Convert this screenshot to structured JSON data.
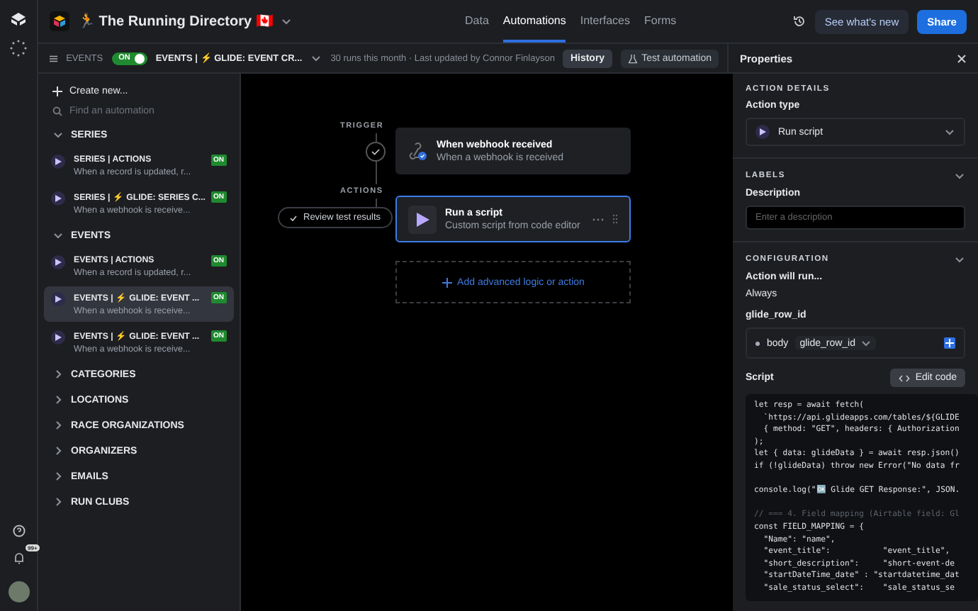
{
  "topbar": {
    "base_emoji": "🏃",
    "base_name": "The Running Directory",
    "flag": "🇨🇦",
    "nav": [
      {
        "label": "Data",
        "selected": false
      },
      {
        "label": "Automations",
        "selected": true
      },
      {
        "label": "Interfaces",
        "selected": false
      },
      {
        "label": "Forms",
        "selected": false
      }
    ],
    "whats_new": "See what's new",
    "share": "Share"
  },
  "subbar": {
    "section": "EVENTS",
    "toggle": {
      "label": "ON",
      "on": true
    },
    "automation_name": "EVENTS | ⚡ GLIDE: EVENT CR...",
    "runs_info": "30 runs this month · Last updated by Connor Finlayson",
    "history": "History",
    "test": "Test automation"
  },
  "sidebar": {
    "create": "Create new...",
    "search_placeholder": "Find an automation",
    "groups": [
      {
        "label": "SERIES",
        "expanded": true,
        "items": [
          {
            "title": "SERIES | ACTIONS",
            "subtitle": "When a record is updated, r...",
            "on_label": "ON",
            "selected": false
          },
          {
            "title": "SERIES | ⚡ GLIDE: SERIES C...",
            "subtitle": "When a webhook is receive...",
            "on_label": "ON",
            "selected": false
          }
        ]
      },
      {
        "label": "EVENTS",
        "expanded": true,
        "items": [
          {
            "title": "EVENTS | ACTIONS",
            "subtitle": "When a record is updated, r...",
            "on_label": "ON",
            "selected": false
          },
          {
            "title": "EVENTS | ⚡ GLIDE: EVENT ...",
            "subtitle": "When a webhook is receive...",
            "on_label": "ON",
            "selected": true
          },
          {
            "title": "EVENTS | ⚡ GLIDE: EVENT ...",
            "subtitle": "When a webhook is receive...",
            "on_label": "ON",
            "selected": false
          }
        ]
      },
      {
        "label": "CATEGORIES",
        "expanded": false
      },
      {
        "label": "LOCATIONS",
        "expanded": false
      },
      {
        "label": "RACE ORGANIZATIONS",
        "expanded": false
      },
      {
        "label": "ORGANIZERS",
        "expanded": false
      },
      {
        "label": "EMAILS",
        "expanded": false
      },
      {
        "label": "RUN CLUBS",
        "expanded": false
      }
    ]
  },
  "rail": {
    "notification_badge": "99+"
  },
  "canvas": {
    "trigger_label": "TRIGGER",
    "actions_label": "ACTIONS",
    "review": "Review test results",
    "trigger": {
      "title": "When webhook received",
      "subtitle": "When a webhook is received"
    },
    "action": {
      "title": "Run a script",
      "subtitle": "Custom script from code editor",
      "selected": true
    },
    "add": "Add advanced logic or action"
  },
  "properties": {
    "title": "Properties",
    "action_details": "ACTION DETAILS",
    "action_type_label": "Action type",
    "action_type": "Run script",
    "labels": "LABELS",
    "description_label": "Description",
    "description_placeholder": "Enter a description",
    "configuration": "CONFIGURATION",
    "will_run_label": "Action will run...",
    "will_run": "Always",
    "param_name": "glide_row_id",
    "param_source": "body",
    "param_value": "glide_row_id",
    "script_label": "Script",
    "edit_code": "Edit code",
    "code": [
      {
        "kind": "code",
        "text": "let resp = await fetch("
      },
      {
        "kind": "code",
        "text": "  `https://api.glideapps.com/tables/${GLIDE"
      },
      {
        "kind": "code",
        "text": "  { method: \"GET\", headers: { Authorization"
      },
      {
        "kind": "code",
        "text": ");"
      },
      {
        "kind": "code",
        "text": "let { data: glideData } = await resp.json()"
      },
      {
        "kind": "code",
        "text": "if (!glideData) throw new Error(\"No data fr"
      },
      {
        "kind": "blank"
      },
      {
        "kind": "code",
        "text": "console.log(\"🆗 Glide GET Response:\", JSON."
      },
      {
        "kind": "blank"
      },
      {
        "kind": "comment",
        "text": "// === 4. Field mapping (Airtable field: Gl"
      },
      {
        "kind": "code",
        "text": "const FIELD_MAPPING = {"
      },
      {
        "kind": "code",
        "text": "  \"Name\": \"name\","
      },
      {
        "kind": "code",
        "text": "  \"event_title\":           \"event_title\","
      },
      {
        "kind": "code",
        "text": "  \"short_description\":     \"short-event-de"
      },
      {
        "kind": "code",
        "text": "  \"startDateTime_date\" : \"startdatetime_dat"
      },
      {
        "kind": "code",
        "text": "  \"sale_status_select\":    \"sale_status_se"
      }
    ]
  }
}
